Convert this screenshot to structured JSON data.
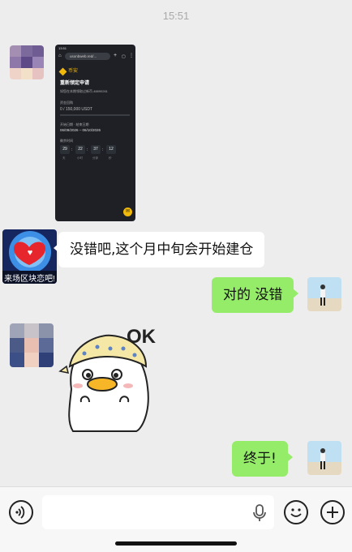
{
  "status": {
    "time": "15:51"
  },
  "chat": {
    "shared_screenshot": {
      "status_time": "13:51",
      "url": "usonbweb.red/...",
      "exchange_name": "币安",
      "headline": "重新领定申请",
      "subline": "如您在本期领取过新币,48890261",
      "amount_label": "资金回购",
      "amount_value": "0 / 150,000 USDT",
      "period_label": "开始日期 · 结束日期",
      "period_value": "06/09/2026 – 06/10/2026",
      "countdown_label": "剩余时间",
      "countdown": [
        "29",
        "22",
        "37",
        "12"
      ],
      "countdown_units": [
        "天",
        "小时",
        "分钟",
        "秒"
      ]
    },
    "message_1": "没错吧,这个月中旬会开始建仓",
    "avatar_caption": "来场区块恋吧!",
    "reply_1": "对的 没错",
    "sticker_text": "OK",
    "reply_2": "终于!"
  },
  "colors": {
    "background": "#ededed",
    "bubble_out": "#95ec69",
    "bubble_in": "#ffffff",
    "binance_yellow": "#f0b90b"
  }
}
